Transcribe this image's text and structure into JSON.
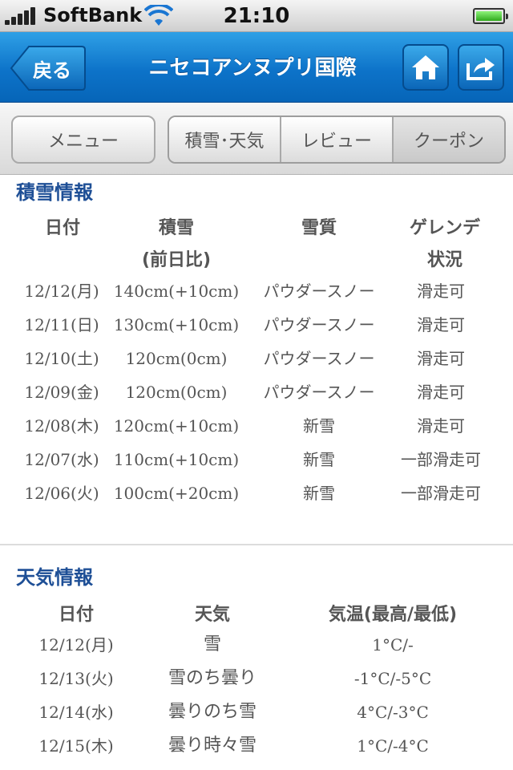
{
  "statusbar": {
    "carrier": "SoftBank",
    "time": "21:10"
  },
  "navbar": {
    "back_label": "戻る",
    "title": "ニセコアンヌプリ国際"
  },
  "toolbar": {
    "menu_label": "メニュー",
    "tabs": [
      {
        "label": "積雪･天気"
      },
      {
        "label": "レビュー"
      },
      {
        "label": "クーポン"
      }
    ]
  },
  "snow": {
    "title": "積雪情報",
    "headers": {
      "date": "日付",
      "depth": "積雪",
      "depth_sub": "(前日比)",
      "quality": "雪質",
      "slope": "ゲレンデ",
      "slope_sub": "状況"
    },
    "rows": [
      {
        "date": "12/12(月)",
        "depth": "140cm(+10cm)",
        "quality": "パウダースノー",
        "status": "滑走可"
      },
      {
        "date": "12/11(日)",
        "depth": "130cm(+10cm)",
        "quality": "パウダースノー",
        "status": "滑走可"
      },
      {
        "date": "12/10(土)",
        "depth": "120cm(0cm)",
        "quality": "パウダースノー",
        "status": "滑走可"
      },
      {
        "date": "12/09(金)",
        "depth": "120cm(0cm)",
        "quality": "パウダースノー",
        "status": "滑走可"
      },
      {
        "date": "12/08(木)",
        "depth": "120cm(+10cm)",
        "quality": "新雪",
        "status": "滑走可"
      },
      {
        "date": "12/07(水)",
        "depth": "110cm(+10cm)",
        "quality": "新雪",
        "status": "一部滑走可"
      },
      {
        "date": "12/06(火)",
        "depth": "100cm(+20cm)",
        "quality": "新雪",
        "status": "一部滑走可"
      }
    ]
  },
  "weather": {
    "title": "天気情報",
    "headers": {
      "date": "日付",
      "weather": "天気",
      "temp": "気温(最高/最低)"
    },
    "rows": [
      {
        "date": "12/12(月)",
        "weather": "雪",
        "temp": "1°C/-"
      },
      {
        "date": "12/13(火)",
        "weather": "雪のち曇り",
        "temp": "-1°C/-5°C"
      },
      {
        "date": "12/14(水)",
        "weather": "曇りのち雪",
        "temp": "4°C/-3°C"
      },
      {
        "date": "12/15(木)",
        "weather": "曇り時々雪",
        "temp": "1°C/-4°C"
      }
    ]
  },
  "colors": {
    "navbar": "#0d73c9",
    "section_title": "#1e4f96"
  }
}
